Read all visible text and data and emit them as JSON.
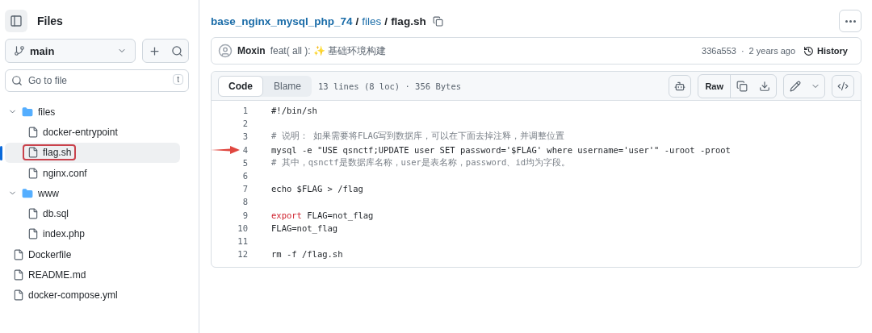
{
  "sidebar": {
    "title": "Files",
    "branch": "main",
    "search": {
      "placeholder": "Go to file",
      "shortcut": "t"
    },
    "tree": [
      {
        "name": "files",
        "kind": "folder",
        "expanded": true,
        "children": [
          {
            "name": "docker-entrypoint",
            "kind": "file",
            "selected": false,
            "annotated": false
          },
          {
            "name": "flag.sh",
            "kind": "file",
            "selected": true,
            "annotated": true
          },
          {
            "name": "nginx.conf",
            "kind": "file",
            "selected": false,
            "annotated": false
          }
        ]
      },
      {
        "name": "www",
        "kind": "folder",
        "expanded": true,
        "children": [
          {
            "name": "db.sql",
            "kind": "file",
            "selected": false,
            "annotated": false
          },
          {
            "name": "index.php",
            "kind": "file",
            "selected": false,
            "annotated": false
          }
        ]
      },
      {
        "name": "Dockerfile",
        "kind": "file",
        "selected": false,
        "annotated": false
      },
      {
        "name": "README.md",
        "kind": "file",
        "selected": false,
        "annotated": false
      },
      {
        "name": "docker-compose.yml",
        "kind": "file",
        "selected": false,
        "annotated": false
      }
    ]
  },
  "breadcrumb": [
    {
      "label": "base_nginx_mysql_php_74",
      "link": true
    },
    {
      "label": "/",
      "link": false
    },
    {
      "label": "files",
      "link": true
    },
    {
      "label": "/",
      "link": false
    },
    {
      "label": "flag.sh",
      "link": false
    }
  ],
  "commit": {
    "author": "Moxin",
    "message": "feat( all ): ✨ 基础环境构建",
    "hash": "336a553",
    "separator": "·",
    "time": "2 years ago",
    "history": "History"
  },
  "file_header": {
    "tabs": [
      {
        "label": "Code",
        "selected": true
      },
      {
        "label": "Blame",
        "selected": false
      }
    ],
    "info": "13 lines (8 loc) · 356 Bytes",
    "raw": "Raw"
  },
  "code": [
    {
      "number": "1",
      "segments": [
        {
          "text": "#!/bin/sh",
          "kind": "plain"
        }
      ]
    },
    {
      "number": "2"
    },
    {
      "number": "3",
      "segments": [
        {
          "text": "# 说明： 如果需要将FLAG写到数据库，可以在下面去掉注释，并调整位置",
          "kind": "comment"
        }
      ]
    },
    {
      "number": "4",
      "annotated": true,
      "segments": [
        {
          "text": "mysql -e \"USE qsnctf;UPDATE user SET password='$FLAG' where username='user'\" -uroot -proot",
          "kind": "plain"
        }
      ]
    },
    {
      "number": "5",
      "segments": [
        {
          "text": "# 其中，qsnctf是数据库名称，user是表名称，password、id均为字段。",
          "kind": "comment"
        }
      ]
    },
    {
      "number": "6"
    },
    {
      "number": "7",
      "segments": [
        {
          "text": "echo $FLAG > /flag",
          "kind": "plain"
        }
      ]
    },
    {
      "number": "8"
    },
    {
      "number": "9",
      "segments": [
        {
          "text": "export",
          "kind": "keyword"
        },
        {
          "text": " FLAG=not_flag",
          "kind": "plain"
        }
      ]
    },
    {
      "number": "10",
      "segments": [
        {
          "text": "FLAG=not_flag",
          "kind": "plain"
        }
      ]
    },
    {
      "number": "11"
    },
    {
      "number": "12",
      "segments": [
        {
          "text": "rm -f /flag.sh",
          "kind": "plain"
        }
      ]
    }
  ]
}
